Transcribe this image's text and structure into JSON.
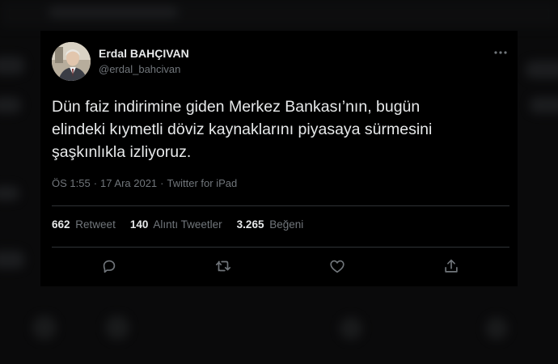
{
  "author": {
    "name": "Erdal BAHÇIVAN",
    "handle": "@erdal_bahcivan"
  },
  "tweet": {
    "line1": "Dün faiz indirimine giden Merkez Bankası’nın, bugün",
    "line2": "elindeki kıymetli döviz kaynaklarını piyasaya sürmesini",
    "line3": "şaşkınlıkla izliyoruz."
  },
  "meta": {
    "time": "ÖS 1:55",
    "separator": "·",
    "date": "17 Ara 2021",
    "source": "Twitter for iPad"
  },
  "stats": {
    "retweets_count": "662",
    "retweets_label": "Retweet",
    "quotes_count": "140",
    "quotes_label": "Alıntı Tweetler",
    "likes_count": "3.265",
    "likes_label": "Beğeni"
  },
  "colors": {
    "background": "#000000",
    "text_primary": "#e7e9ea",
    "text_secondary": "#71767b",
    "divider": "#2f3336"
  },
  "icons": {
    "more": "more-dots-icon",
    "reply": "reply-icon",
    "retweet": "retweet-icon",
    "like": "heart-icon",
    "share": "share-icon"
  }
}
